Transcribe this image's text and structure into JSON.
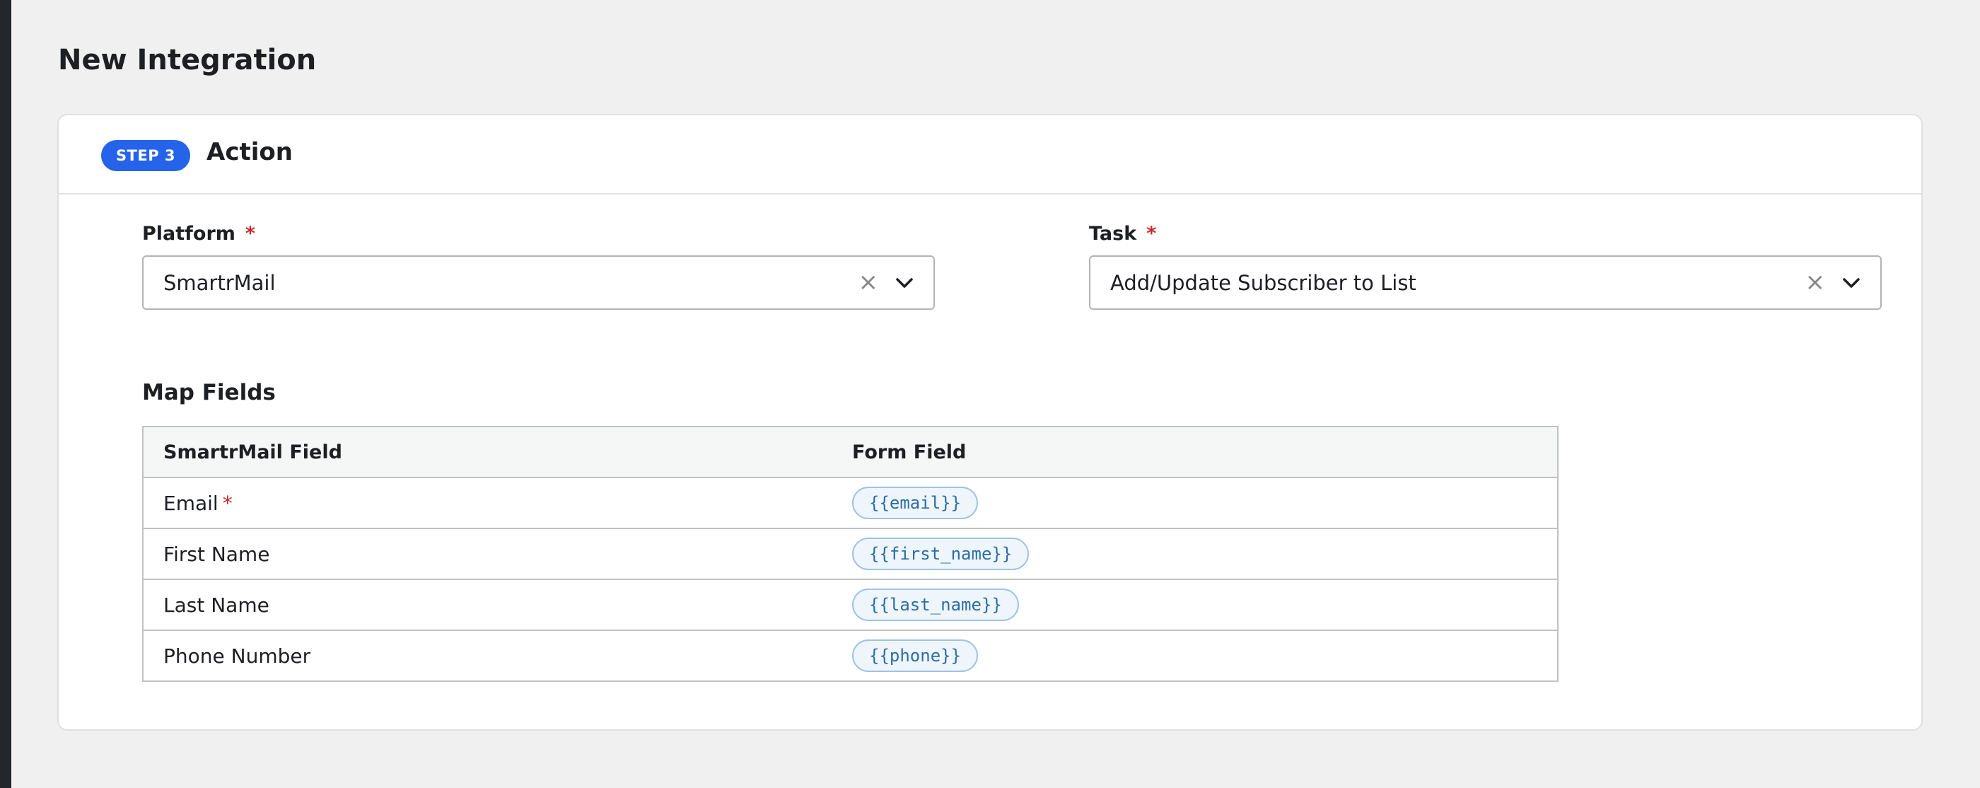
{
  "page": {
    "title": "New Integration"
  },
  "step": {
    "badge": "STEP 3",
    "title": "Action"
  },
  "platform": {
    "label": "Platform",
    "required_mark": "*",
    "value": "SmartrMail",
    "clear_glyph": "×"
  },
  "task": {
    "label": "Task",
    "required_mark": "*",
    "value": "Add/Update Subscriber to List",
    "clear_glyph": "×"
  },
  "map_fields": {
    "title": "Map Fields",
    "columns": [
      "SmartrMail Field",
      "Form Field"
    ],
    "rows": [
      {
        "field": "Email",
        "required": true,
        "required_mark": "*",
        "token": "{{email}}"
      },
      {
        "field": "First Name",
        "required": false,
        "token": "{{first_name}}"
      },
      {
        "field": "Last Name",
        "required": false,
        "token": "{{last_name}}"
      },
      {
        "field": "Phone Number",
        "required": false,
        "token": "{{phone}}"
      }
    ]
  },
  "colors": {
    "accent": "#2563eb",
    "required": "#c62828",
    "token_text": "#2c6ea8",
    "token_bg": "#eef5fb",
    "background": "#f0f0f0"
  },
  "icons": {
    "clear": "close-icon",
    "dropdown": "chevron-down-icon"
  }
}
